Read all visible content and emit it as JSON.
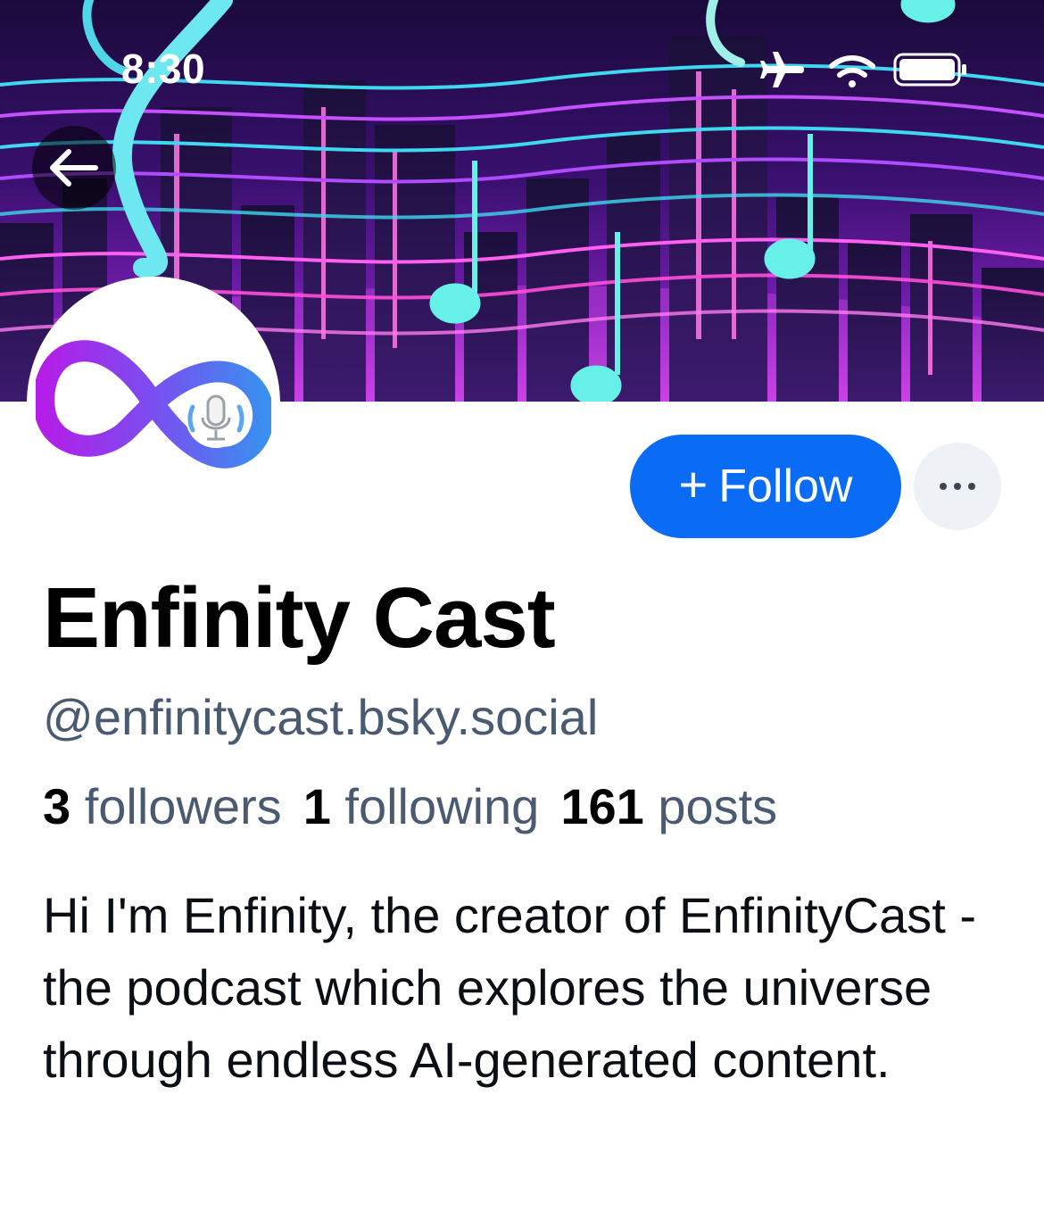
{
  "status_bar": {
    "time": "8:30"
  },
  "profile": {
    "display_name": "Enfinity Cast",
    "handle": "@enfinitycast.bsky.social",
    "stats": {
      "followers_count": "3",
      "followers_label": "followers",
      "following_count": "1",
      "following_label": "following",
      "posts_count": "161",
      "posts_label": "posts"
    },
    "bio": "Hi I'm Enfinity, the creator of EnfinityCast - the podcast which explores the universe through endless AI-generated content."
  },
  "actions": {
    "follow_plus": "+",
    "follow_label": "Follow"
  },
  "icons": {
    "back": "arrow-left-icon",
    "more": "ellipsis-icon",
    "airplane": "airplane-mode-icon",
    "wifi": "wifi-icon",
    "battery": "battery-icon"
  },
  "colors": {
    "follow_button": "#0a6bf5",
    "secondary_text": "#4a5a70",
    "more_button_bg": "#eef1f5"
  }
}
